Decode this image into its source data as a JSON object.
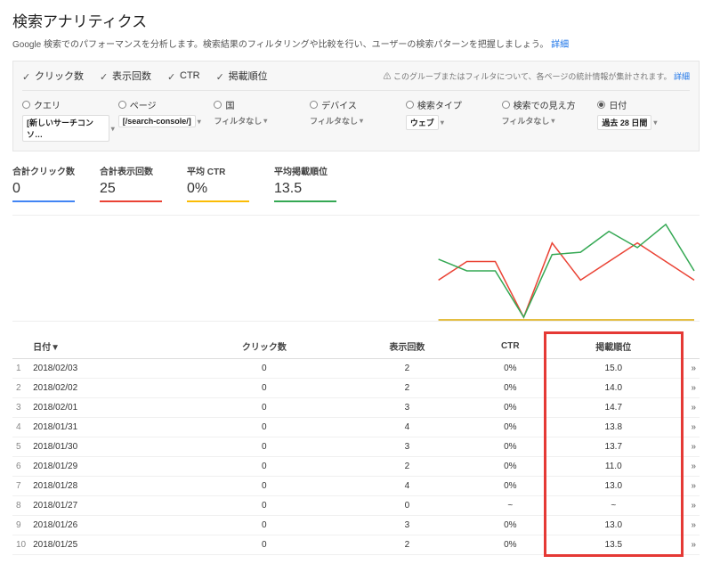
{
  "header": {
    "title": "検索アナリティクス",
    "subtitle": "Google 検索でのパフォーマンスを分析します。検索結果のフィルタリングや比較を行い、ユーザーの検索パターンを把握しましょう。",
    "subtitle_link": "詳細"
  },
  "metrics": {
    "items": [
      "クリック数",
      "表示回数",
      "CTR",
      "掲載順位"
    ],
    "notice_prefix": "⚠ このグループまたはフィルタについて、各ページの統計情報が集計されます。",
    "notice_link": "詳細"
  },
  "filters": [
    {
      "label": "クエリ",
      "value": "[新しいサーチコンソ… ",
      "set": true,
      "selected": false
    },
    {
      "label": "ページ",
      "value": "[/search-console/] ",
      "set": true,
      "selected": false
    },
    {
      "label": "国",
      "value": "フィルタなし ",
      "set": false,
      "selected": false
    },
    {
      "label": "デバイス",
      "value": "フィルタなし ",
      "set": false,
      "selected": false
    },
    {
      "label": "検索タイプ",
      "value": "ウェブ ",
      "set": true,
      "selected": false
    },
    {
      "label": "検索での見え方",
      "value": "フィルタなし ",
      "set": false,
      "selected": false
    },
    {
      "label": "日付",
      "value": "過去 28 日間 ",
      "set": true,
      "selected": true
    }
  ],
  "totals": [
    {
      "label": "合計クリック数",
      "value": "0",
      "color": "blue"
    },
    {
      "label": "合計表示回数",
      "value": "25",
      "color": "red"
    },
    {
      "label": "平均 CTR",
      "value": "0%",
      "color": "yellow"
    },
    {
      "label": "平均掲載順位",
      "value": "13.5",
      "color": "green"
    }
  ],
  "table": {
    "columns": {
      "date": "日付▼",
      "clicks": "クリック数",
      "impr": "表示回数",
      "ctr": "CTR",
      "pos": "掲載順位"
    },
    "rows": [
      {
        "n": "1",
        "date": "2018/02/03",
        "clicks": "0",
        "impr": "2",
        "ctr": "0%",
        "pos": "15.0"
      },
      {
        "n": "2",
        "date": "2018/02/02",
        "clicks": "0",
        "impr": "2",
        "ctr": "0%",
        "pos": "14.0"
      },
      {
        "n": "3",
        "date": "2018/02/01",
        "clicks": "0",
        "impr": "3",
        "ctr": "0%",
        "pos": "14.7"
      },
      {
        "n": "4",
        "date": "2018/01/31",
        "clicks": "0",
        "impr": "4",
        "ctr": "0%",
        "pos": "13.8"
      },
      {
        "n": "5",
        "date": "2018/01/30",
        "clicks": "0",
        "impr": "3",
        "ctr": "0%",
        "pos": "13.7"
      },
      {
        "n": "6",
        "date": "2018/01/29",
        "clicks": "0",
        "impr": "2",
        "ctr": "0%",
        "pos": "11.0"
      },
      {
        "n": "7",
        "date": "2018/01/28",
        "clicks": "0",
        "impr": "4",
        "ctr": "0%",
        "pos": "13.0"
      },
      {
        "n": "8",
        "date": "2018/01/27",
        "clicks": "0",
        "impr": "0",
        "ctr": "~",
        "pos": "~"
      },
      {
        "n": "9",
        "date": "2018/01/26",
        "clicks": "0",
        "impr": "3",
        "ctr": "0%",
        "pos": "13.0"
      },
      {
        "n": "10",
        "date": "2018/01/25",
        "clicks": "0",
        "impr": "2",
        "ctr": "0%",
        "pos": "13.5"
      }
    ]
  },
  "chart_data": {
    "type": "line",
    "x_fraction_start": 0.62,
    "series": [
      {
        "name": "クリック数",
        "color": "#4285f4",
        "values": [
          0,
          0,
          0,
          0,
          0,
          0,
          0,
          0,
          0,
          0
        ]
      },
      {
        "name": "表示回数",
        "color": "#ea4335",
        "values": [
          2,
          3,
          3,
          0,
          4,
          2,
          3,
          4,
          3,
          2
        ]
      },
      {
        "name": "CTR",
        "color": "#fbbc05",
        "values": [
          0,
          0,
          0,
          0,
          0,
          0,
          0,
          0,
          0,
          0
        ]
      },
      {
        "name": "掲載順位",
        "color": "#34a853",
        "values": [
          13.5,
          13.0,
          13.0,
          11.0,
          13.7,
          13.8,
          14.7,
          14.0,
          15.0,
          13.0
        ],
        "y_range": [
          11,
          15
        ]
      }
    ],
    "impr_range": [
      0,
      5
    ]
  }
}
